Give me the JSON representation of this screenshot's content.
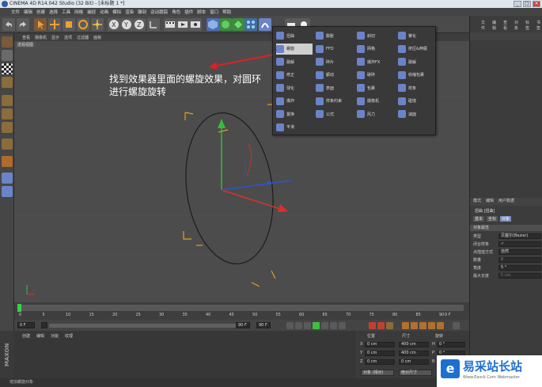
{
  "window": {
    "title": "CINEMA 4D R14.042 Studio (32 Bit) - [未标题 1 *]"
  },
  "menubar": [
    "文件",
    "编辑",
    "创建",
    "选择",
    "工具",
    "网格",
    "捕捉",
    "动画",
    "模拟",
    "渲染",
    "雕刻",
    "运动跟踪",
    "角色",
    "插件",
    "脚本",
    "窗口",
    "帮助"
  ],
  "viewport": {
    "menu": [
      "查看",
      "摄像机",
      "显示",
      "选项",
      "过滤器",
      "面板"
    ],
    "label": "透视视图",
    "annotation_line1": "找到效果器里面的螺旋效果，对圆环",
    "annotation_line2": "进行螺旋旋转"
  },
  "deformer_menu": {
    "items": [
      {
        "label": "扭曲",
        "selected": false
      },
      {
        "label": "螺旋",
        "selected": true
      },
      {
        "label": "融解",
        "selected": false
      },
      {
        "label": "修正",
        "selected": false
      },
      {
        "label": "球化",
        "selected": false
      },
      {
        "label": "爆炸",
        "selected": false
      },
      {
        "label": "置换",
        "selected": false
      },
      {
        "label": "平滑",
        "selected": false
      },
      {
        "label": "膨胀",
        "selected": false
      },
      {
        "label": "FFD",
        "selected": false
      },
      {
        "label": "碎片",
        "selected": false
      },
      {
        "label": "颤动",
        "selected": false
      },
      {
        "label": "表面",
        "selected": false
      },
      {
        "label": "样条约束",
        "selected": false
      },
      {
        "label": "公式",
        "selected": false
      },
      {
        "label": "斜切",
        "selected": false
      },
      {
        "label": "网格",
        "selected": false
      },
      {
        "label": "爆炸FX",
        "selected": false
      },
      {
        "label": "破碎",
        "selected": false
      },
      {
        "label": "包裹",
        "selected": false
      },
      {
        "label": "摄像机",
        "selected": false
      },
      {
        "label": "风力",
        "selected": false
      },
      {
        "label": "锥化",
        "selected": false
      },
      {
        "label": "挤压&伸展",
        "selected": false
      },
      {
        "label": "融解",
        "selected": false
      },
      {
        "label": "收缩包裹",
        "selected": false
      },
      {
        "label": "样条",
        "selected": false
      },
      {
        "label": "碰撞",
        "selected": false
      },
      {
        "label": "减面",
        "selected": false
      }
    ]
  },
  "right_panel": {
    "top_tabs": [
      "文件",
      "编辑",
      "查看",
      "对象",
      "标签",
      "书签"
    ],
    "mid_tabs": [
      "模式",
      "编辑",
      "用户数据"
    ],
    "object_title": "扭曲 [扭曲]",
    "attr_tabs": [
      {
        "label": "基本",
        "active": false
      },
      {
        "label": "坐标",
        "active": false
      },
      {
        "label": "对象",
        "active": true
      }
    ],
    "section_title": "对象属性",
    "rows": [
      {
        "label": "类型",
        "value": "贝塞尔(Bezier)",
        "dim": false
      },
      {
        "label": "闭合样条",
        "value": "✓",
        "dim": false
      },
      {
        "label": "点插值方式",
        "value": "自然",
        "dim": false
      },
      {
        "label": "数量",
        "value": "8",
        "dim": true
      },
      {
        "label": "角度",
        "value": "5 °",
        "dim": false
      },
      {
        "label": "最大长度",
        "value": "5 cm",
        "dim": true
      }
    ]
  },
  "timeline": {
    "ticks": [
      "0",
      "5",
      "10",
      "15",
      "20",
      "25",
      "30",
      "35",
      "40",
      "45",
      "50",
      "55",
      "60",
      "65",
      "70",
      "75",
      "80",
      "85",
      "90"
    ],
    "current": "0 F"
  },
  "transport": {
    "start": "0 F",
    "end": "90 F",
    "range_end": "90 F"
  },
  "materials_menu": [
    "创建",
    "编辑",
    "功能",
    "纹理"
  ],
  "coordinates": {
    "headers": [
      "位置",
      "尺寸",
      "旋转"
    ],
    "rows": [
      {
        "axis": "X",
        "pos": "0 cm",
        "size": "400 cm",
        "rot_axis": "H",
        "rot": "0 °"
      },
      {
        "axis": "Y",
        "pos": "0 cm",
        "size": "400 cm",
        "rot_axis": "P",
        "rot": "0 °"
      },
      {
        "axis": "Z",
        "pos": "0 cm",
        "size": "0 cm",
        "rot_axis": "B",
        "rot": "0 °"
      }
    ],
    "mode_button": "对象 (相对)",
    "size_button": "绝对尺寸",
    "apply_button": "应用"
  },
  "status": "增加螺旋对象",
  "brand": {
    "maxon": "MAXON CINEMA 4D"
  },
  "watermark": {
    "title": "易采站长站",
    "subtitle": "Www.Easck.Com Webmaster",
    "logo": "e"
  },
  "colors": {
    "selected_item": "#cfcfcf",
    "deformer_icon": "#6b84c8",
    "axis_y": "#2fbf3a",
    "axis_x": "#d8312b",
    "axis_z": "#2f55c9",
    "annotation_arrow": "#e02020",
    "deformer_corner": "#e0a020"
  }
}
